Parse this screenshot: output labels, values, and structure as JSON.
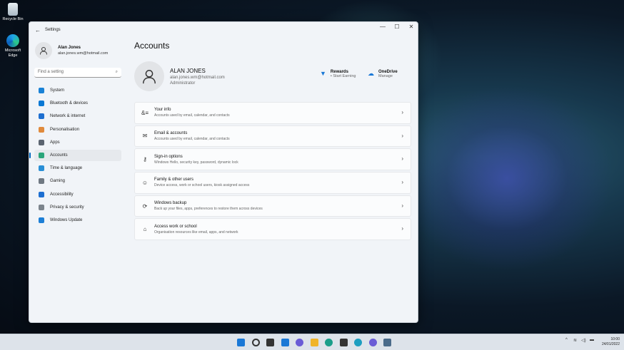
{
  "desktop": {
    "icons": [
      {
        "label": "Recycle Bin"
      },
      {
        "label": "Microsoft Edge"
      }
    ]
  },
  "window": {
    "title": "Settings",
    "controls": {
      "minimize": "—",
      "maximize": "☐",
      "close": "✕"
    }
  },
  "sidebar": {
    "user": {
      "name": "Alan Jones",
      "email": "alan.jones.wm@hotmail.com"
    },
    "search_placeholder": "Find a setting",
    "items": [
      {
        "label": "System",
        "color": "#1a82d6"
      },
      {
        "label": "Bluetooth & devices",
        "color": "#0a78d4"
      },
      {
        "label": "Network & internet",
        "color": "#1e6fd0"
      },
      {
        "label": "Personalisation",
        "color": "#e08a3c"
      },
      {
        "label": "Apps",
        "color": "#5b6470"
      },
      {
        "label": "Accounts",
        "color": "#2aa57a",
        "active": true
      },
      {
        "label": "Time & language",
        "color": "#2a8fd6"
      },
      {
        "label": "Gaming",
        "color": "#6f7882"
      },
      {
        "label": "Accessibility",
        "color": "#1d6fd1"
      },
      {
        "label": "Privacy & security",
        "color": "#7c848c"
      },
      {
        "label": "Windows Update",
        "color": "#1d7fd6"
      }
    ]
  },
  "main": {
    "title": "Accounts",
    "account": {
      "name": "ALAN JONES",
      "email": "alan.jones.wm@hotmail.com",
      "role": "Administrator"
    },
    "rewards": {
      "title": "Rewards",
      "sub": "• Start Earning"
    },
    "onedrive": {
      "title": "OneDrive",
      "sub": "Manage"
    },
    "cards": [
      {
        "icon": "your-info-icon",
        "glyph": "&≡",
        "title": "Your info",
        "sub": "Accounts used by email, calendar, and contacts"
      },
      {
        "icon": "mail-icon",
        "glyph": "✉",
        "title": "Email & accounts",
        "sub": "Accounts used by email, calendar, and contacts"
      },
      {
        "icon": "key-icon",
        "glyph": "⚷",
        "title": "Sign-in options",
        "sub": "Windows Hello, security key, password, dynamic lock"
      },
      {
        "icon": "family-icon",
        "glyph": "☺",
        "title": "Family & other users",
        "sub": "Device access, work or school users, kiosk assigned access"
      },
      {
        "icon": "backup-icon",
        "glyph": "⟳",
        "title": "Windows backup",
        "sub": "Back up your files, apps, preferences to restore them across devices"
      },
      {
        "icon": "briefcase-icon",
        "glyph": "⌂",
        "title": "Access work or school",
        "sub": "Organisation resources like email, apps, and network"
      }
    ]
  },
  "taskbar": {
    "apps": [
      {
        "name": "start",
        "color": "#1a78d6"
      },
      {
        "name": "search",
        "color": "#333"
      },
      {
        "name": "task-view",
        "color": "#333"
      },
      {
        "name": "widgets",
        "color": "#1a78d6"
      },
      {
        "name": "chat",
        "color": "#6a5cd6"
      },
      {
        "name": "file-explorer",
        "color": "#f0b429"
      },
      {
        "name": "edge",
        "color": "#1a9e8a"
      },
      {
        "name": "store",
        "color": "#333"
      },
      {
        "name": "app-teal",
        "color": "#1d9ec0"
      },
      {
        "name": "app-purple",
        "color": "#6a5cd6"
      },
      {
        "name": "settings",
        "color": "#4a6b8a"
      }
    ],
    "time": "10:00",
    "date": "24/01/2022"
  }
}
